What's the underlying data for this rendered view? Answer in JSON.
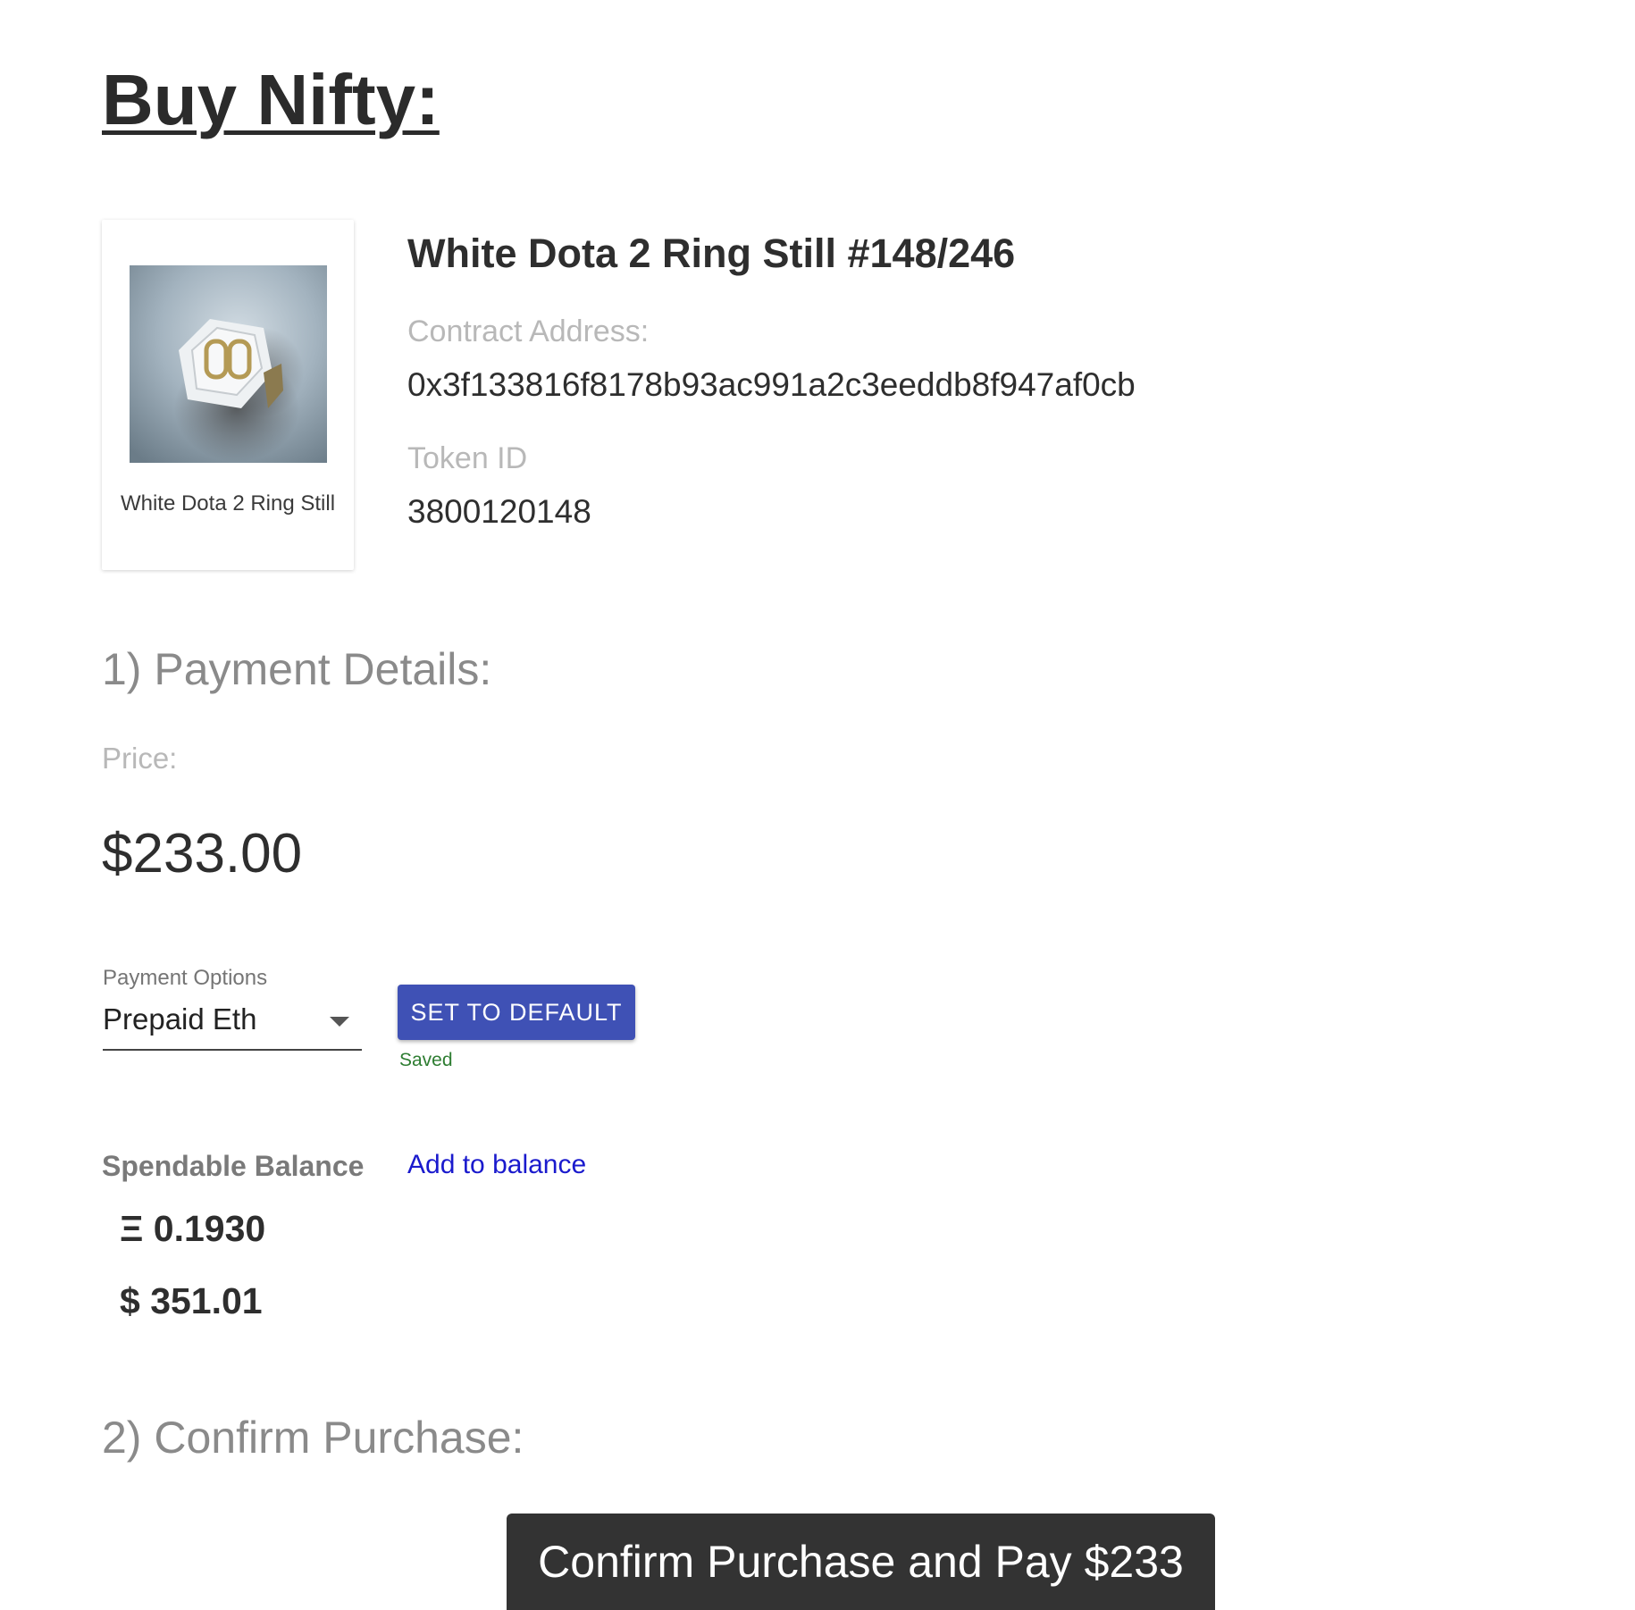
{
  "page": {
    "title": "Buy Nifty:"
  },
  "nifty": {
    "image_caption": "White Dota 2 Ring Still",
    "name": "White Dota 2 Ring Still #148/246",
    "contract_label": "Contract Address:",
    "contract_address": "0x3f133816f8178b93ac991a2c3eeddb8f947af0cb",
    "token_label": "Token ID",
    "token_id": "3800120148"
  },
  "payment": {
    "heading": "1) Payment Details:",
    "price_label": "Price:",
    "price_value": "$233.00",
    "options_label": "Payment Options",
    "selected_option": "Prepaid Eth",
    "set_default_label": "SET TO DEFAULT",
    "saved_text": "Saved"
  },
  "balance": {
    "label": "Spendable Balance",
    "add_link": "Add to balance",
    "eth": "Ξ 0.1930",
    "usd": "$ 351.01"
  },
  "confirm": {
    "heading": "2) Confirm Purchase:",
    "button_label": "Confirm Purchase and Pay $233"
  },
  "colors": {
    "primary_button": "#3f51b5",
    "confirm_button": "#333333",
    "saved_green": "#2e7d32",
    "link_blue": "#1a1acd"
  },
  "icons": {
    "select_arrow": "chevron-down-icon",
    "nifty_image": "ring-image"
  }
}
